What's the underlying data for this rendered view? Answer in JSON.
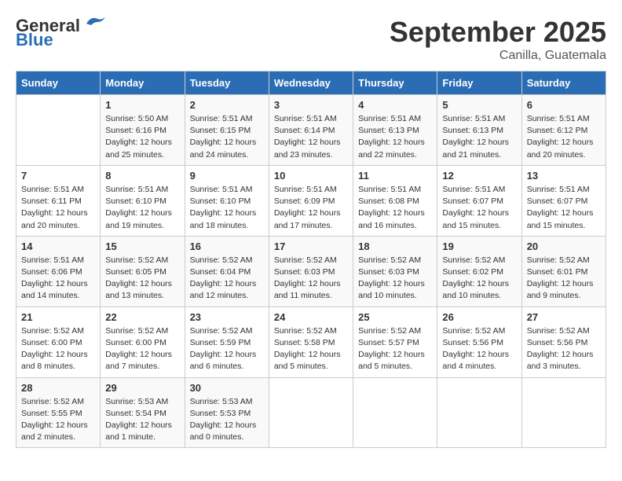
{
  "header": {
    "logo_line1": "General",
    "logo_line2": "Blue",
    "month": "September 2025",
    "location": "Canilla, Guatemala"
  },
  "days_of_week": [
    "Sunday",
    "Monday",
    "Tuesday",
    "Wednesday",
    "Thursday",
    "Friday",
    "Saturday"
  ],
  "weeks": [
    [
      {
        "day": "",
        "info": ""
      },
      {
        "day": "1",
        "info": "Sunrise: 5:50 AM\nSunset: 6:16 PM\nDaylight: 12 hours\nand 25 minutes."
      },
      {
        "day": "2",
        "info": "Sunrise: 5:51 AM\nSunset: 6:15 PM\nDaylight: 12 hours\nand 24 minutes."
      },
      {
        "day": "3",
        "info": "Sunrise: 5:51 AM\nSunset: 6:14 PM\nDaylight: 12 hours\nand 23 minutes."
      },
      {
        "day": "4",
        "info": "Sunrise: 5:51 AM\nSunset: 6:13 PM\nDaylight: 12 hours\nand 22 minutes."
      },
      {
        "day": "5",
        "info": "Sunrise: 5:51 AM\nSunset: 6:13 PM\nDaylight: 12 hours\nand 21 minutes."
      },
      {
        "day": "6",
        "info": "Sunrise: 5:51 AM\nSunset: 6:12 PM\nDaylight: 12 hours\nand 20 minutes."
      }
    ],
    [
      {
        "day": "7",
        "info": "Sunrise: 5:51 AM\nSunset: 6:11 PM\nDaylight: 12 hours\nand 20 minutes."
      },
      {
        "day": "8",
        "info": "Sunrise: 5:51 AM\nSunset: 6:10 PM\nDaylight: 12 hours\nand 19 minutes."
      },
      {
        "day": "9",
        "info": "Sunrise: 5:51 AM\nSunset: 6:10 PM\nDaylight: 12 hours\nand 18 minutes."
      },
      {
        "day": "10",
        "info": "Sunrise: 5:51 AM\nSunset: 6:09 PM\nDaylight: 12 hours\nand 17 minutes."
      },
      {
        "day": "11",
        "info": "Sunrise: 5:51 AM\nSunset: 6:08 PM\nDaylight: 12 hours\nand 16 minutes."
      },
      {
        "day": "12",
        "info": "Sunrise: 5:51 AM\nSunset: 6:07 PM\nDaylight: 12 hours\nand 15 minutes."
      },
      {
        "day": "13",
        "info": "Sunrise: 5:51 AM\nSunset: 6:07 PM\nDaylight: 12 hours\nand 15 minutes."
      }
    ],
    [
      {
        "day": "14",
        "info": "Sunrise: 5:51 AM\nSunset: 6:06 PM\nDaylight: 12 hours\nand 14 minutes."
      },
      {
        "day": "15",
        "info": "Sunrise: 5:52 AM\nSunset: 6:05 PM\nDaylight: 12 hours\nand 13 minutes."
      },
      {
        "day": "16",
        "info": "Sunrise: 5:52 AM\nSunset: 6:04 PM\nDaylight: 12 hours\nand 12 minutes."
      },
      {
        "day": "17",
        "info": "Sunrise: 5:52 AM\nSunset: 6:03 PM\nDaylight: 12 hours\nand 11 minutes."
      },
      {
        "day": "18",
        "info": "Sunrise: 5:52 AM\nSunset: 6:03 PM\nDaylight: 12 hours\nand 10 minutes."
      },
      {
        "day": "19",
        "info": "Sunrise: 5:52 AM\nSunset: 6:02 PM\nDaylight: 12 hours\nand 10 minutes."
      },
      {
        "day": "20",
        "info": "Sunrise: 5:52 AM\nSunset: 6:01 PM\nDaylight: 12 hours\nand 9 minutes."
      }
    ],
    [
      {
        "day": "21",
        "info": "Sunrise: 5:52 AM\nSunset: 6:00 PM\nDaylight: 12 hours\nand 8 minutes."
      },
      {
        "day": "22",
        "info": "Sunrise: 5:52 AM\nSunset: 6:00 PM\nDaylight: 12 hours\nand 7 minutes."
      },
      {
        "day": "23",
        "info": "Sunrise: 5:52 AM\nSunset: 5:59 PM\nDaylight: 12 hours\nand 6 minutes."
      },
      {
        "day": "24",
        "info": "Sunrise: 5:52 AM\nSunset: 5:58 PM\nDaylight: 12 hours\nand 5 minutes."
      },
      {
        "day": "25",
        "info": "Sunrise: 5:52 AM\nSunset: 5:57 PM\nDaylight: 12 hours\nand 5 minutes."
      },
      {
        "day": "26",
        "info": "Sunrise: 5:52 AM\nSunset: 5:56 PM\nDaylight: 12 hours\nand 4 minutes."
      },
      {
        "day": "27",
        "info": "Sunrise: 5:52 AM\nSunset: 5:56 PM\nDaylight: 12 hours\nand 3 minutes."
      }
    ],
    [
      {
        "day": "28",
        "info": "Sunrise: 5:52 AM\nSunset: 5:55 PM\nDaylight: 12 hours\nand 2 minutes."
      },
      {
        "day": "29",
        "info": "Sunrise: 5:53 AM\nSunset: 5:54 PM\nDaylight: 12 hours\nand 1 minute."
      },
      {
        "day": "30",
        "info": "Sunrise: 5:53 AM\nSunset: 5:53 PM\nDaylight: 12 hours\nand 0 minutes."
      },
      {
        "day": "",
        "info": ""
      },
      {
        "day": "",
        "info": ""
      },
      {
        "day": "",
        "info": ""
      },
      {
        "day": "",
        "info": ""
      }
    ]
  ]
}
